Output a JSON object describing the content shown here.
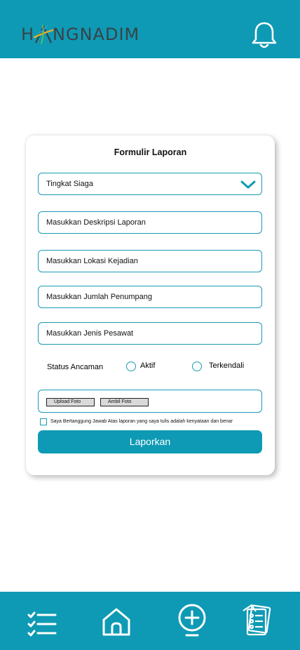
{
  "header": {
    "logo_text_pre": "H",
    "logo_text_post": "NGNADIM",
    "logo_full": "HANGNADIM",
    "bell_icon": "bell-icon"
  },
  "form": {
    "title": "Formulir Laporan",
    "alert_select": {
      "value": "Tingkat Siaga",
      "icon": "chevron-down-icon"
    },
    "description_placeholder": "Masukkan Deskripsi Laporan",
    "location_placeholder": "Masukkan Lokasi Kejadian",
    "passengers_placeholder": "Masukkan Jumlah Penumpang",
    "aircraft_placeholder": "Masukkan Jenis Pesawat",
    "status": {
      "label": "Status Ancaman",
      "options": [
        "Aktif",
        "Terkendali"
      ]
    },
    "upload_photo_label": "Upload Foto",
    "take_photo_label": "Ambil Foto",
    "agreement_text": "Saya Bertanggung Jawab Atas laporan yang saya tulis adalah kenyataan dan benar",
    "submit_label": "Laporkan"
  },
  "bottom_nav": {
    "items": [
      "checklist-icon",
      "home-icon",
      "add-circle-icon",
      "reports-icon"
    ]
  },
  "colors": {
    "brand": "#0e9ab4",
    "logo_text": "#3a4248"
  }
}
